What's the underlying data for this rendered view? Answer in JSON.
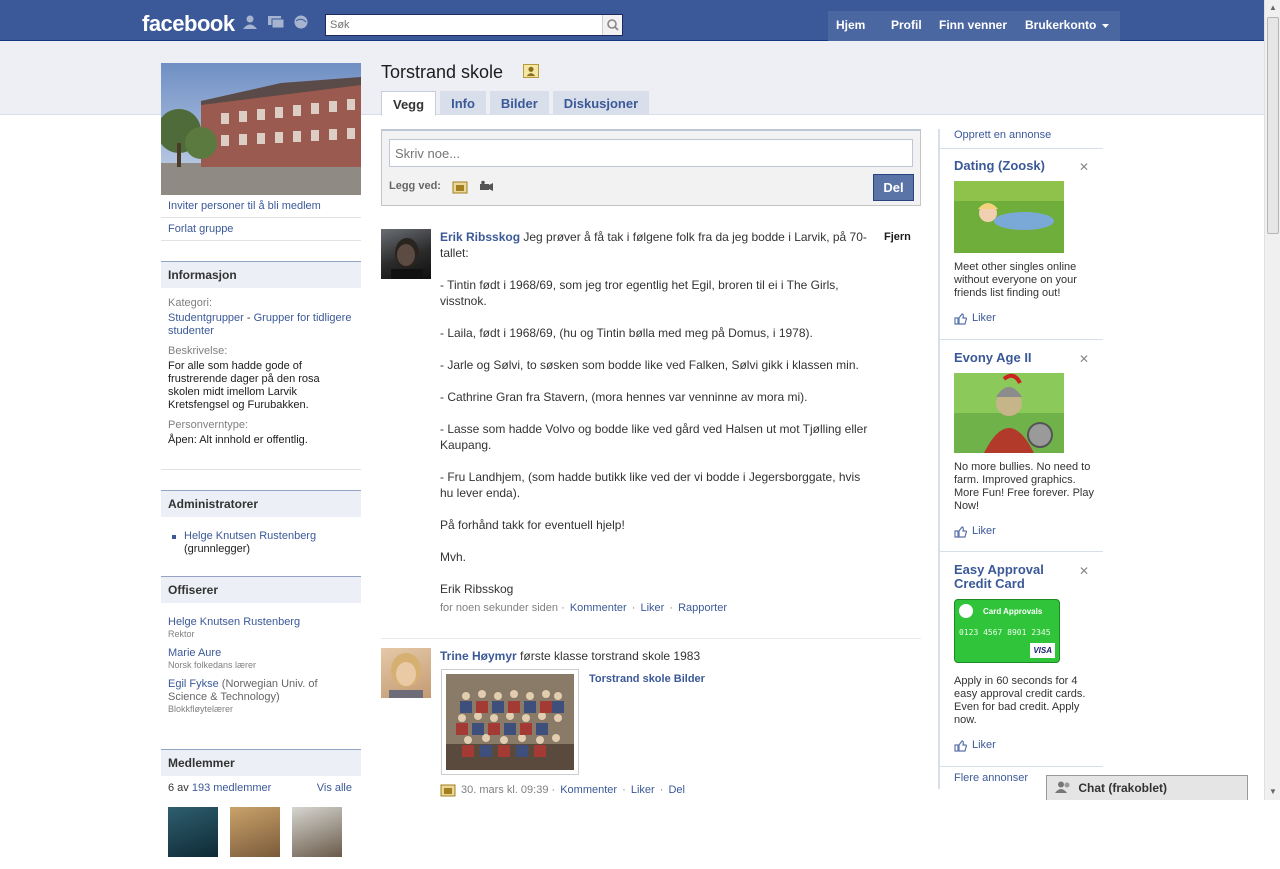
{
  "topbar": {
    "logo": "facebook",
    "search_placeholder": "Søk",
    "nav": [
      "Hjem",
      "Profil",
      "Finn venner",
      "Brukerkonto"
    ]
  },
  "group": {
    "title": "Torstrand skole",
    "tabs": [
      "Vegg",
      "Info",
      "Bilder",
      "Diskusjoner"
    ],
    "active_tab": "Vegg"
  },
  "left": {
    "links": [
      "Inviter personer til å bli medlem",
      "Forlat gruppe"
    ],
    "info": {
      "heading": "Informasjon",
      "category_label": "Kategori:",
      "category_a": "Studentgrupper",
      "category_sep": " - ",
      "category_b": "Grupper for tidligere studenter",
      "description_label": "Beskrivelse:",
      "description": "For alle som hadde gode of frustrerende dager på den rosa skolen midt imellom Larvik Kretsfengsel og Furubakken.",
      "privacy_label": "Personverntype:",
      "privacy": "Åpen: Alt innhold er offentlig."
    },
    "admins": {
      "heading": "Administratorer",
      "name": "Helge Knutsen Rustenberg",
      "role": "(grunnlegger)"
    },
    "officers": {
      "heading": "Offiserer",
      "items": [
        {
          "name": "Helge Knutsen Rustenberg",
          "extra": "",
          "title": "Rektor"
        },
        {
          "name": "Marie Aure",
          "extra": "",
          "title": "Norsk folkedans lærer"
        },
        {
          "name": "Egil Fykse",
          "extra": " (Norwegian Univ. of Science & Technology)",
          "title": "Blokkfløytelærer"
        }
      ]
    },
    "members": {
      "heading": "Medlemmer",
      "count_prefix": "6 av ",
      "count_link": "193 medlemmer",
      "see_all": "Vis alle"
    }
  },
  "composer": {
    "placeholder": "Skriv noe...",
    "attach_label": "Legg ved:",
    "submit": "Del"
  },
  "posts": [
    {
      "author": "Erik Ribsskog",
      "remove": "Fjern",
      "intro": "Jeg prøver å få tak i følgene folk fra da jeg bodde i Larvik, på 70-tallet:",
      "paragraphs": [
        "- Tintin født i 1968/69, som jeg tror egentlig het Egil, broren til ei i The Girls, visstnok.",
        "- Laila, født i 1968/69, (hu og Tintin bølla med meg på Domus, i 1978).",
        "- Jarle og Sølvi, to søsken som bodde like ved Falken, Sølvi gikk i klassen min.",
        "- Cathrine Gran fra Stavern, (mora hennes var venninne av mora mi).",
        "- Lasse som hadde Volvo og bodde like ved gård ved Halsen ut mot Tjølling eller Kaupang.",
        "- Fru Landhjem, (som hadde butikk like ved der vi bodde i Jegersborggate, hvis hu lever enda).",
        "På forhånd takk for eventuell hjelp!",
        "Mvh.",
        "Erik Ribsskog"
      ],
      "time": "for noen sekunder siden",
      "actions": [
        "Kommenter",
        "Liker",
        "Rapporter"
      ]
    },
    {
      "author": "Trine Høymyr",
      "text": "første klasse torstrand skole 1983",
      "album_link": "Torstrand skole Bilder",
      "time": "30. mars kl. 09:39",
      "actions": [
        "Kommenter",
        "Liker",
        "Del"
      ]
    }
  ],
  "ads": {
    "create": "Opprett en annonse",
    "items": [
      {
        "title": "Dating (Zoosk)",
        "text": "Meet other singles online without everyone on your friends list finding out!",
        "like": "Liker"
      },
      {
        "title": "Evony Age II",
        "text": "No more bullies. No need to farm. Improved graphics. More Fun! Free forever. Play Now!",
        "like": "Liker"
      },
      {
        "title": "Easy Approval Credit Card",
        "card_label": "Card Approvals",
        "card_number": "0123 4567 8901 2345",
        "card_brand": "VISA",
        "text": "Apply in 60 seconds for 4 easy approval credit cards. Even for bad credit. Apply now.",
        "like": "Liker"
      }
    ],
    "more": "Flere annonser"
  },
  "chat": {
    "label": "Chat (frakoblet)"
  },
  "colors": {
    "brand": "#3b5998",
    "band": "#edeff4",
    "link": "#3b5998"
  }
}
